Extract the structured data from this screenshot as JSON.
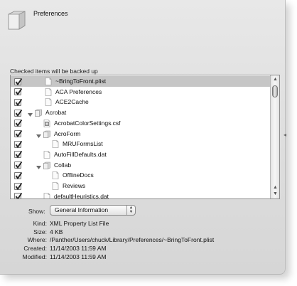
{
  "header": {
    "title": "Preferences",
    "icon": "folder-icon"
  },
  "list": {
    "caption": "Checked items will be backed up",
    "rows": [
      {
        "label": "~BringToFront.plist",
        "checked": true,
        "level": 0,
        "kind": "file",
        "expandable": false,
        "selected": true
      },
      {
        "label": "ACA Preferences",
        "checked": true,
        "level": 0,
        "kind": "file",
        "expandable": false
      },
      {
        "label": "ACE2Cache",
        "checked": true,
        "level": 0,
        "kind": "file",
        "expandable": false
      },
      {
        "label": "Acrobat",
        "checked": true,
        "level": 0,
        "kind": "folder",
        "expandable": true
      },
      {
        "label": "AcrobatColorSettings.csf",
        "checked": true,
        "level": 1,
        "kind": "settings",
        "expandable": false
      },
      {
        "label": "AcroForm",
        "checked": true,
        "level": 1,
        "kind": "folder",
        "expandable": true
      },
      {
        "label": "MRUFormsList",
        "checked": true,
        "level": 2,
        "kind": "file",
        "expandable": false
      },
      {
        "label": "AutoFillDefaults.dat",
        "checked": true,
        "level": 1,
        "kind": "file",
        "expandable": false
      },
      {
        "label": "Collab",
        "checked": true,
        "level": 1,
        "kind": "folder",
        "expandable": true
      },
      {
        "label": "OfflineDocs",
        "checked": true,
        "level": 2,
        "kind": "file",
        "expandable": false
      },
      {
        "label": "Reviews",
        "checked": true,
        "level": 2,
        "kind": "file",
        "expandable": false
      },
      {
        "label": "defaultHeuristics.dat",
        "checked": true,
        "level": 1,
        "kind": "file",
        "expandable": false
      }
    ]
  },
  "show": {
    "label": "Show:",
    "value": "General Information"
  },
  "info": [
    {
      "key": "Kind:",
      "value": "XML Property List File"
    },
    {
      "key": "Size:",
      "value": "4 KB"
    },
    {
      "key": "Where:",
      "value": "/Panther/Users/chuck/Library/Preferences/~BringToFront.plist"
    },
    {
      "key": "Created:",
      "value": "11/14/2003 11:59 AM"
    },
    {
      "key": "Modified:",
      "value": "11/14/2003 11:59 AM"
    }
  ],
  "colors": {
    "selection": "#c6c6c6",
    "window": "#e0e0e0"
  }
}
